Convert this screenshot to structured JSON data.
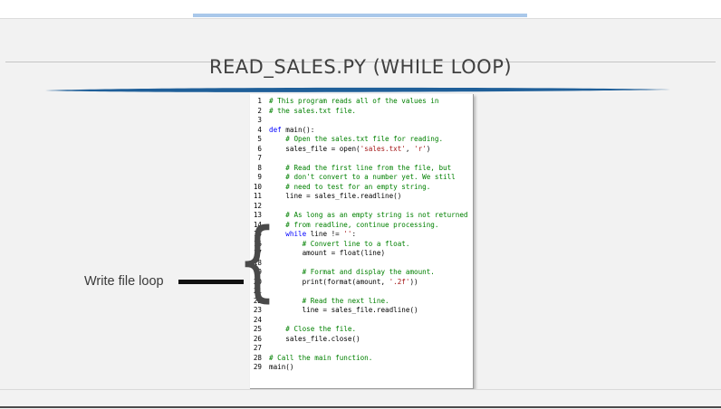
{
  "slide": {
    "title": "READ_SALES.PY (WHILE LOOP)",
    "label": "Write file loop"
  },
  "colors": {
    "comment": "#008000",
    "keyword": "#0000ff",
    "string": "#a31515",
    "accent": "#a9c8ea",
    "swoosh": "#1f5f99"
  },
  "code": {
    "lines": [
      {
        "n": "1",
        "indent": 0,
        "tokens": [
          {
            "t": "comment",
            "v": "# This program reads all of the values in"
          }
        ]
      },
      {
        "n": "2",
        "indent": 0,
        "tokens": [
          {
            "t": "comment",
            "v": "# the sales.txt file."
          }
        ]
      },
      {
        "n": "3",
        "indent": 0,
        "tokens": []
      },
      {
        "n": "4",
        "indent": 0,
        "tokens": [
          {
            "t": "keyword",
            "v": "def"
          },
          {
            "t": "plain",
            "v": " main():"
          }
        ]
      },
      {
        "n": "5",
        "indent": 1,
        "tokens": [
          {
            "t": "comment",
            "v": "# Open the sales.txt file for reading."
          }
        ]
      },
      {
        "n": "6",
        "indent": 1,
        "tokens": [
          {
            "t": "plain",
            "v": "sales_file = open("
          },
          {
            "t": "string",
            "v": "'sales.txt'"
          },
          {
            "t": "plain",
            "v": ", "
          },
          {
            "t": "string",
            "v": "'r'"
          },
          {
            "t": "plain",
            "v": ")"
          }
        ]
      },
      {
        "n": "7",
        "indent": 0,
        "tokens": []
      },
      {
        "n": "8",
        "indent": 1,
        "tokens": [
          {
            "t": "comment",
            "v": "# Read the first line from the file, but"
          }
        ]
      },
      {
        "n": "9",
        "indent": 1,
        "tokens": [
          {
            "t": "comment",
            "v": "# don't convert to a number yet. We still"
          }
        ]
      },
      {
        "n": "10",
        "indent": 1,
        "tokens": [
          {
            "t": "comment",
            "v": "# need to test for an empty string."
          }
        ]
      },
      {
        "n": "11",
        "indent": 1,
        "tokens": [
          {
            "t": "plain",
            "v": "line = sales_file.readline()"
          }
        ]
      },
      {
        "n": "12",
        "indent": 0,
        "tokens": []
      },
      {
        "n": "13",
        "indent": 1,
        "tokens": [
          {
            "t": "comment",
            "v": "# As long as an empty string is not returned"
          }
        ]
      },
      {
        "n": "14",
        "indent": 1,
        "tokens": [
          {
            "t": "comment",
            "v": "# from readline, continue processing."
          }
        ]
      },
      {
        "n": "15",
        "indent": 1,
        "tokens": [
          {
            "t": "keyword",
            "v": "while"
          },
          {
            "t": "plain",
            "v": " line != "
          },
          {
            "t": "string",
            "v": "''"
          },
          {
            "t": "plain",
            "v": ":"
          }
        ]
      },
      {
        "n": "16",
        "indent": 2,
        "tokens": [
          {
            "t": "comment",
            "v": "# Convert line to a float."
          }
        ]
      },
      {
        "n": "17",
        "indent": 2,
        "tokens": [
          {
            "t": "plain",
            "v": "amount = float(line)"
          }
        ]
      },
      {
        "n": "18",
        "indent": 0,
        "tokens": []
      },
      {
        "n": "19",
        "indent": 2,
        "tokens": [
          {
            "t": "comment",
            "v": "# Format and display the amount."
          }
        ]
      },
      {
        "n": "20",
        "indent": 2,
        "tokens": [
          {
            "t": "plain",
            "v": "print(format(amount, "
          },
          {
            "t": "string",
            "v": "'.2f'"
          },
          {
            "t": "plain",
            "v": "))"
          }
        ]
      },
      {
        "n": "21",
        "indent": 0,
        "tokens": []
      },
      {
        "n": "22",
        "indent": 2,
        "tokens": [
          {
            "t": "comment",
            "v": "# Read the next line."
          }
        ]
      },
      {
        "n": "23",
        "indent": 2,
        "tokens": [
          {
            "t": "plain",
            "v": "line = sales_file.readline()"
          }
        ]
      },
      {
        "n": "24",
        "indent": 0,
        "tokens": []
      },
      {
        "n": "25",
        "indent": 1,
        "tokens": [
          {
            "t": "comment",
            "v": "# Close the file."
          }
        ]
      },
      {
        "n": "26",
        "indent": 1,
        "tokens": [
          {
            "t": "plain",
            "v": "sales_file.close()"
          }
        ]
      },
      {
        "n": "27",
        "indent": 0,
        "tokens": []
      },
      {
        "n": "28",
        "indent": 0,
        "tokens": [
          {
            "t": "comment",
            "v": "# Call the main function."
          }
        ]
      },
      {
        "n": "29",
        "indent": 0,
        "tokens": [
          {
            "t": "plain",
            "v": "main()"
          }
        ]
      }
    ]
  }
}
